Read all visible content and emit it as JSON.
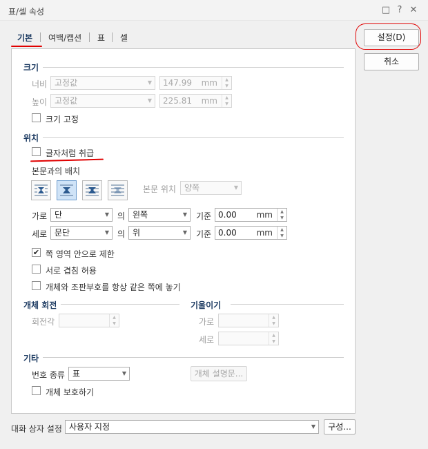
{
  "window": {
    "title": "표/셀 속성"
  },
  "tabs": [
    {
      "label": "기본"
    },
    {
      "label": "여백/캡션"
    },
    {
      "label": "표"
    },
    {
      "label": "셀"
    }
  ],
  "buttons": {
    "ok": "설정(D)",
    "cancel": "취소",
    "configure": "구성...",
    "object_desc": "개체 설명문..."
  },
  "size": {
    "heading": "크기",
    "width_label": "너비",
    "width_mode": "고정값",
    "width_value": "147.99",
    "width_unit": "mm",
    "height_label": "높이",
    "height_mode": "고정값",
    "height_value": "225.81",
    "height_unit": "mm",
    "fix_size_label": "크기 고정",
    "fix_size_checked": false
  },
  "position": {
    "heading": "위치",
    "treat_as_char_label": "글자처럼 취급",
    "treat_as_char_checked": false,
    "text_wrap_label": "본문과의 배치",
    "wrap_options": [
      "어울림",
      "자리 차지",
      "글 앞으로",
      "글 뒤로"
    ],
    "wrap_selected": 1,
    "body_pos_label": "본문 위치",
    "body_pos_value": "양쪽",
    "horiz_label": "가로",
    "horiz_ref": "단",
    "horiz_of": "의",
    "horiz_align": "왼쪽",
    "horiz_base_label": "기준",
    "horiz_value": "0.00",
    "horiz_unit": "mm",
    "vert_label": "세로",
    "vert_ref": "문단",
    "vert_of": "의",
    "vert_align": "위",
    "vert_base_label": "기준",
    "vert_value": "0.00",
    "vert_unit": "mm",
    "limit_page_label": "쪽 영역 안으로 제한",
    "limit_page_checked": true,
    "allow_overlap_label": "서로 겹침 허용",
    "allow_overlap_checked": false,
    "keep_with_anchor_label": "개체와 조판부호를 항상 같은 쪽에 놓기",
    "keep_with_anchor_checked": false
  },
  "rotation": {
    "heading": "개체 회전",
    "angle_label": "회전각",
    "angle_value": ""
  },
  "skew": {
    "heading": "기울이기",
    "horiz_label": "가로",
    "horiz_value": "",
    "vert_label": "세로",
    "vert_value": ""
  },
  "etc": {
    "heading": "기타",
    "numbering_label": "번호 종류",
    "numbering_value": "표",
    "protect_label": "개체 보호하기",
    "protect_checked": false
  },
  "dialog_settings": {
    "label": "대화 상자 설정",
    "value": "사용자 지정"
  },
  "colors": {
    "accent": "#1d3b62",
    "annotation": "#e00000",
    "selected": "#cfe3f7"
  }
}
